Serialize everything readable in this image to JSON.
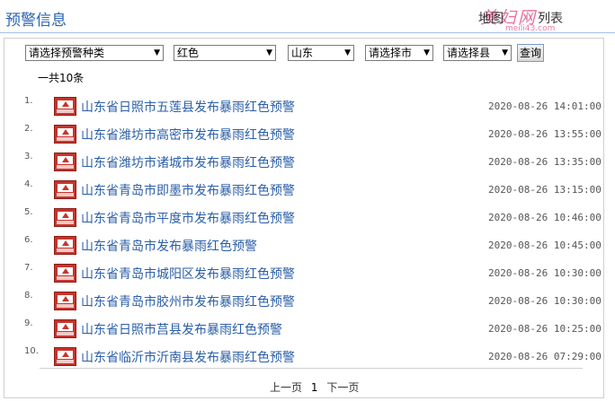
{
  "header": {
    "title": "预警信息",
    "tab_map": "地图",
    "tab_list": "列表",
    "separator": "|"
  },
  "watermark": {
    "brand": "美妇网",
    "domain": "meili43.com"
  },
  "filters": {
    "type": "请选择预警种类",
    "color": "红色",
    "province": "山东",
    "city": "请选择市",
    "county": "请选择县",
    "query_label": "查询"
  },
  "summary": {
    "count": "一共10条"
  },
  "rows": [
    {
      "num": "1.",
      "title": "山东省日照市五莲县发布暴雨红色预警",
      "time": "2020-08-26 14:01:00"
    },
    {
      "num": "2.",
      "title": "山东省潍坊市高密市发布暴雨红色预警",
      "time": "2020-08-26 13:55:00"
    },
    {
      "num": "3.",
      "title": "山东省潍坊市诸城市发布暴雨红色预警",
      "time": "2020-08-26 13:35:00"
    },
    {
      "num": "4.",
      "title": "山东省青岛市即墨市发布暴雨红色预警",
      "time": "2020-08-26 13:15:00"
    },
    {
      "num": "5.",
      "title": "山东省青岛市平度市发布暴雨红色预警",
      "time": "2020-08-26 10:46:00"
    },
    {
      "num": "6.",
      "title": "山东省青岛市发布暴雨红色预警",
      "time": "2020-08-26 10:45:00"
    },
    {
      "num": "7.",
      "title": "山东省青岛市城阳区发布暴雨红色预警",
      "time": "2020-08-26 10:30:00"
    },
    {
      "num": "8.",
      "title": "山东省青岛市胶州市发布暴雨红色预警",
      "time": "2020-08-26 10:30:00"
    },
    {
      "num": "9.",
      "title": "山东省日照市莒县发布暴雨红色预警",
      "time": "2020-08-26 10:25:00"
    },
    {
      "num": "10.",
      "title": "山东省临沂市沂南县发布暴雨红色预警",
      "time": "2020-08-26 07:29:00"
    }
  ],
  "pager": {
    "prev": "上一页",
    "current": "1",
    "next": "下一页"
  },
  "colors": {
    "title_blue": "#2a63b0",
    "link_blue": "#2a5ea8",
    "alert_red": "#c8342c"
  },
  "icons": {
    "row_icon": "rainstorm-red-warning-icon"
  }
}
